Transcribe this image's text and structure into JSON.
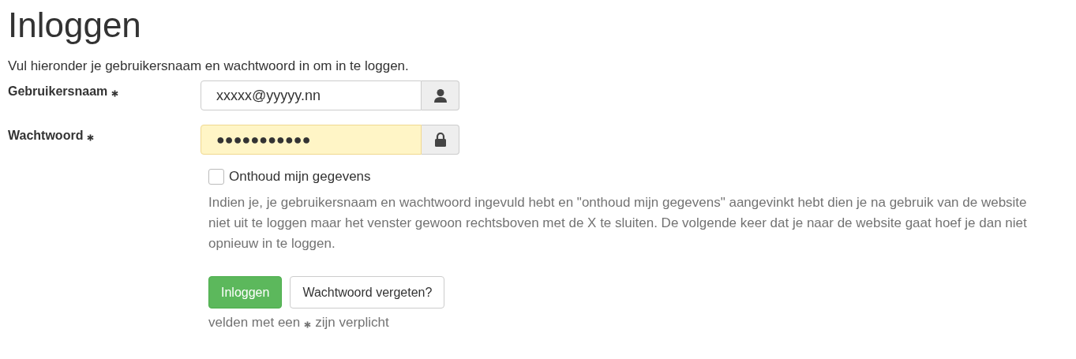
{
  "title": "Inloggen",
  "intro": "Vul hieronder je gebruikersnaam en wachtwoord in om in te loggen.",
  "fields": [
    {
      "label": "Gebruikersnaam",
      "required": true,
      "kind": "user",
      "value": "xxxxx@yyyyy.nn",
      "autofilled": false
    },
    {
      "label": "Wachtwoord",
      "required": true,
      "kind": "lock",
      "value": "●●●●●●●●●●●",
      "autofilled": true
    }
  ],
  "remember": {
    "label": "Onthoud mijn gegevens",
    "checked": false
  },
  "help": "Indien je, je gebruikersnaam en wachtwoord ingevuld hebt en \"onthoud mijn gegevens\" aangevinkt hebt dien je na gebruik van de website niet uit te loggen maar het venster gewoon rechtsboven met de X te sluiten. De volgende keer dat je naar de website gaat hoef je dan niet opnieuw in te loggen.",
  "buttons": [
    {
      "label": "Inloggen",
      "kind": "primary"
    },
    {
      "label": "Wachtwoord vergeten?",
      "kind": "default"
    }
  ],
  "note": {
    "before": "velden met een",
    "after": "zijn verplicht"
  }
}
